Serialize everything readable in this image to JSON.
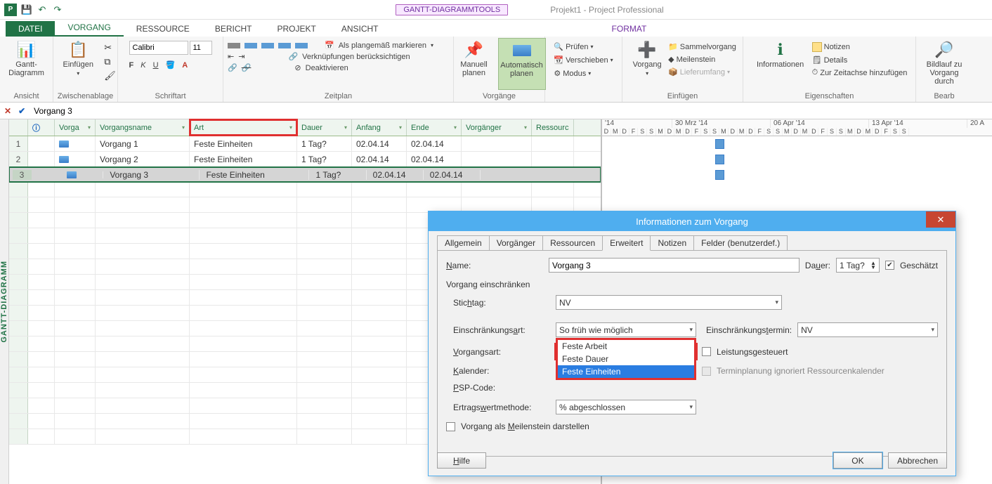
{
  "title_bar": {
    "app_title": "Projekt1 - Project Professional",
    "contextual_tab_group": "GANTT-DIAGRAMMTOOLS",
    "contextual_tab": "FORMAT"
  },
  "ribbon_tabs": {
    "file": "DATEI",
    "tabs": [
      "VORGANG",
      "RESSOURCE",
      "BERICHT",
      "PROJEKT",
      "ANSICHT"
    ],
    "active": "VORGANG"
  },
  "ribbon": {
    "ansicht": {
      "gantt": "Gantt-\nDiagramm",
      "label": "Ansicht"
    },
    "zwischenablage": {
      "einfuegen": "Einfügen",
      "label": "Zwischenablage"
    },
    "schriftart": {
      "font": "Calibri",
      "size": "11",
      "label": "Schriftart",
      "bold": "F",
      "italic": "K",
      "underline": "U"
    },
    "zeitplan": {
      "mark": "Als plangemäß markieren",
      "links": "Verknüpfungen berücksichtigen",
      "deact": "Deaktivieren",
      "label": "Zeitplan"
    },
    "planmode": {
      "manual": "Manuell\nplanen",
      "auto": "Automatisch\nplanen"
    },
    "vorgaenge": {
      "pruefen": "Prüfen",
      "verschieben": "Verschieben",
      "modus": "Modus",
      "label": "Vorgänge"
    },
    "einfuegen2": {
      "vorgang": "Vorgang",
      "sammel": "Sammelvorgang",
      "meilenstein": "Meilenstein",
      "liefer": "Lieferumfang",
      "label": "Einfügen"
    },
    "eigenschaften": {
      "info": "Informationen",
      "notizen": "Notizen",
      "details": "Details",
      "zeitachse": "Zur Zeitachse hinzufügen",
      "label": "Eigenschaften"
    },
    "bearbeiten": {
      "bildlauf": "Bildlauf zu\nVorgang durch",
      "label": "Bearb"
    }
  },
  "formula_bar": {
    "value": "Vorgang 3"
  },
  "columns": {
    "vorga": "Vorga",
    "name": "Vorgangsname",
    "art": "Art",
    "dauer": "Dauer",
    "anfang": "Anfang",
    "ende": "Ende",
    "vorgaenger": "Vorgänger",
    "ressourc": "Ressourc"
  },
  "tasks": [
    {
      "n": 1,
      "name": "Vorgang 1",
      "art": "Feste Einheiten",
      "dauer": "1 Tag?",
      "anfang": "02.04.14",
      "ende": "02.04.14"
    },
    {
      "n": 2,
      "name": "Vorgang 2",
      "art": "Feste Einheiten",
      "dauer": "1 Tag?",
      "anfang": "02.04.14",
      "ende": "02.04.14"
    },
    {
      "n": 3,
      "name": "Vorgang 3",
      "art": "Feste Einheiten",
      "dauer": "1 Tag?",
      "anfang": "02.04.14",
      "ende": "02.04.14"
    }
  ],
  "side_label": "GANTT-DIAGRAMM",
  "timeline": {
    "weeks": [
      "'14",
      "30 Mrz '14",
      "06 Apr '14",
      "13 Apr '14",
      "20 A"
    ],
    "days": "DMDFSSMDMDFSSMDMDFSSMDMDFSSMDMDFSS"
  },
  "dialog": {
    "title": "Informationen zum Vorgang",
    "tabs": [
      "Allgemein",
      "Vorgänger",
      "Ressourcen",
      "Erweitert",
      "Notizen",
      "Felder (benutzerdef.)"
    ],
    "active_tab": "Erweitert",
    "name_label": "Name:",
    "name_value": "Vorgang 3",
    "dauer_label": "Dauer:",
    "dauer_value": "1 Tag?",
    "geschaetzt": "Geschätzt",
    "section": "Vorgang einschränken",
    "stichtag_label": "Stichtag:",
    "stichtag_value": "NV",
    "einschr_art_label": "Einschränkungsart:",
    "einschr_art_value": "So früh wie möglich",
    "einschr_termin_label": "Einschränkungstermin:",
    "einschr_termin_value": "NV",
    "vorgangsart_label": "Vorgangsart:",
    "vorgangsart_value": "Feste Einheiten",
    "vorgangsart_options": [
      "Feste Arbeit",
      "Feste Dauer",
      "Feste Einheiten"
    ],
    "leistung": "Leistungsgesteuert",
    "kalender_label": "Kalender:",
    "terminplan": "Terminplanung ignoriert Ressourcenkalender",
    "psp_label": "PSP-Code:",
    "ertrag_label": "Ertragswertmethode:",
    "ertrag_value": "% abgeschlossen",
    "meilenstein": "Vorgang als Meilenstein darstellen",
    "hilfe": "Hilfe",
    "ok": "OK",
    "abbrechen": "Abbrechen"
  }
}
